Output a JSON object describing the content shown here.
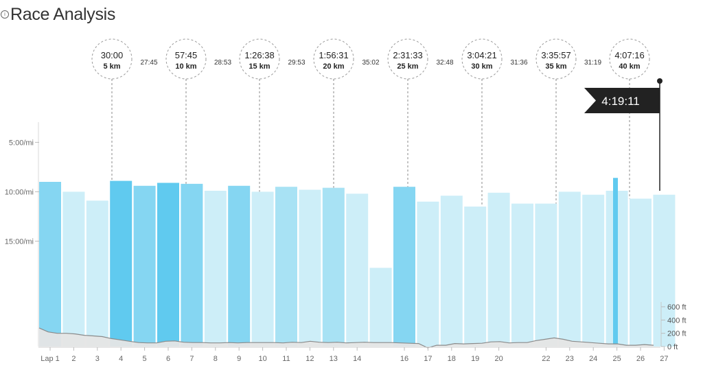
{
  "header": {
    "title": "Race Analysis",
    "info_icon": "info-icon"
  },
  "chart_data": {
    "type": "bar",
    "pace_axis": {
      "ticks": [
        "5:00/mi",
        "10:00/mi",
        "15:00/mi"
      ],
      "values": [
        5,
        10,
        15
      ],
      "range": [
        1.5,
        23.5
      ]
    },
    "elevation_axis": {
      "ticks": [
        "600 ft",
        "400 ft",
        "200 ft",
        "0 ft"
      ],
      "values": [
        600,
        400,
        200,
        0
      ],
      "range": [
        0,
        650
      ]
    },
    "laps": [
      {
        "label": "Lap 1",
        "pace": 9.0,
        "shade": 2
      },
      {
        "label": "2",
        "pace": 10.0,
        "shade": 0
      },
      {
        "label": "3",
        "pace": 10.9,
        "shade": 0
      },
      {
        "label": "4",
        "pace": 8.9,
        "shade": 3
      },
      {
        "label": "5",
        "pace": 9.4,
        "shade": 2
      },
      {
        "label": "6",
        "pace": 9.1,
        "shade": 3
      },
      {
        "label": "7",
        "pace": 9.2,
        "shade": 2
      },
      {
        "label": "8",
        "pace": 9.9,
        "shade": 0
      },
      {
        "label": "9",
        "pace": 9.4,
        "shade": 2
      },
      {
        "label": "10",
        "pace": 10.0,
        "shade": 0
      },
      {
        "label": "11",
        "pace": 9.5,
        "shade": 1
      },
      {
        "label": "12",
        "pace": 9.8,
        "shade": 0
      },
      {
        "label": "13",
        "pace": 9.6,
        "shade": 1
      },
      {
        "label": "14",
        "pace": 10.2,
        "shade": 0
      },
      {
        "label": "",
        "pace": 17.7,
        "shade": 0
      },
      {
        "label": "16",
        "pace": 9.5,
        "shade": 2
      },
      {
        "label": "17",
        "pace": 11.0,
        "shade": 0
      },
      {
        "label": "18",
        "pace": 10.4,
        "shade": 0
      },
      {
        "label": "19",
        "pace": 11.5,
        "shade": 0
      },
      {
        "label": "20",
        "pace": 10.1,
        "shade": 0
      },
      {
        "label": "",
        "pace": 11.2,
        "shade": 0
      },
      {
        "label": "22",
        "pace": 11.2,
        "shade": 0
      },
      {
        "label": "23",
        "pace": 10.0,
        "shade": 0
      },
      {
        "label": "24",
        "pace": 10.3,
        "shade": 0
      },
      {
        "label": "25",
        "pace": 9.9,
        "shade": 0
      },
      {
        "label": "26",
        "pace": 10.7,
        "shade": 0
      },
      {
        "label": "27",
        "pace": 10.3,
        "shade": 0
      },
      {
        "label": "",
        "pace": 8.6,
        "shade": 3
      }
    ],
    "elevation_profile": [
      280,
      220,
      200,
      200,
      190,
      170,
      160,
      150,
      120,
      100,
      80,
      60,
      55,
      55,
      80,
      85,
      65,
      60,
      60,
      55,
      55,
      60,
      55,
      60,
      60,
      60,
      60,
      55,
      65,
      60,
      80,
      65,
      60,
      65,
      55,
      60,
      65,
      60,
      60,
      60,
      55,
      50,
      45,
      -20,
      20,
      20,
      45,
      40,
      45,
      50,
      70,
      75,
      55,
      60,
      60,
      90,
      110,
      130,
      110,
      80,
      70,
      60,
      50,
      40,
      40,
      20,
      20,
      30,
      20
    ],
    "checkpoints": [
      {
        "time": "30:00",
        "dist": "5 km",
        "split": "27:45"
      },
      {
        "time": "57:45",
        "dist": "10 km",
        "split": "28:53"
      },
      {
        "time": "1:26:38",
        "dist": "15 km",
        "split": "29:53"
      },
      {
        "time": "1:56:31",
        "dist": "20 km",
        "split": "35:02"
      },
      {
        "time": "2:31:33",
        "dist": "25 km",
        "split": "32:48"
      },
      {
        "time": "3:04:21",
        "dist": "30 km",
        "split": "31:36"
      },
      {
        "time": "3:35:57",
        "dist": "35 km",
        "split": "31:19"
      },
      {
        "time": "4:07:16",
        "dist": "40 km",
        "split": ""
      }
    ],
    "finish_time": "4:19:11",
    "colors": {
      "shades": [
        "#cdeef8",
        "#a8e2f4",
        "#85d6f2",
        "#60caef"
      ],
      "elevation_fill": "#e5e5e5",
      "elevation_line": "#8a8a8a",
      "flag": "#222222"
    }
  }
}
